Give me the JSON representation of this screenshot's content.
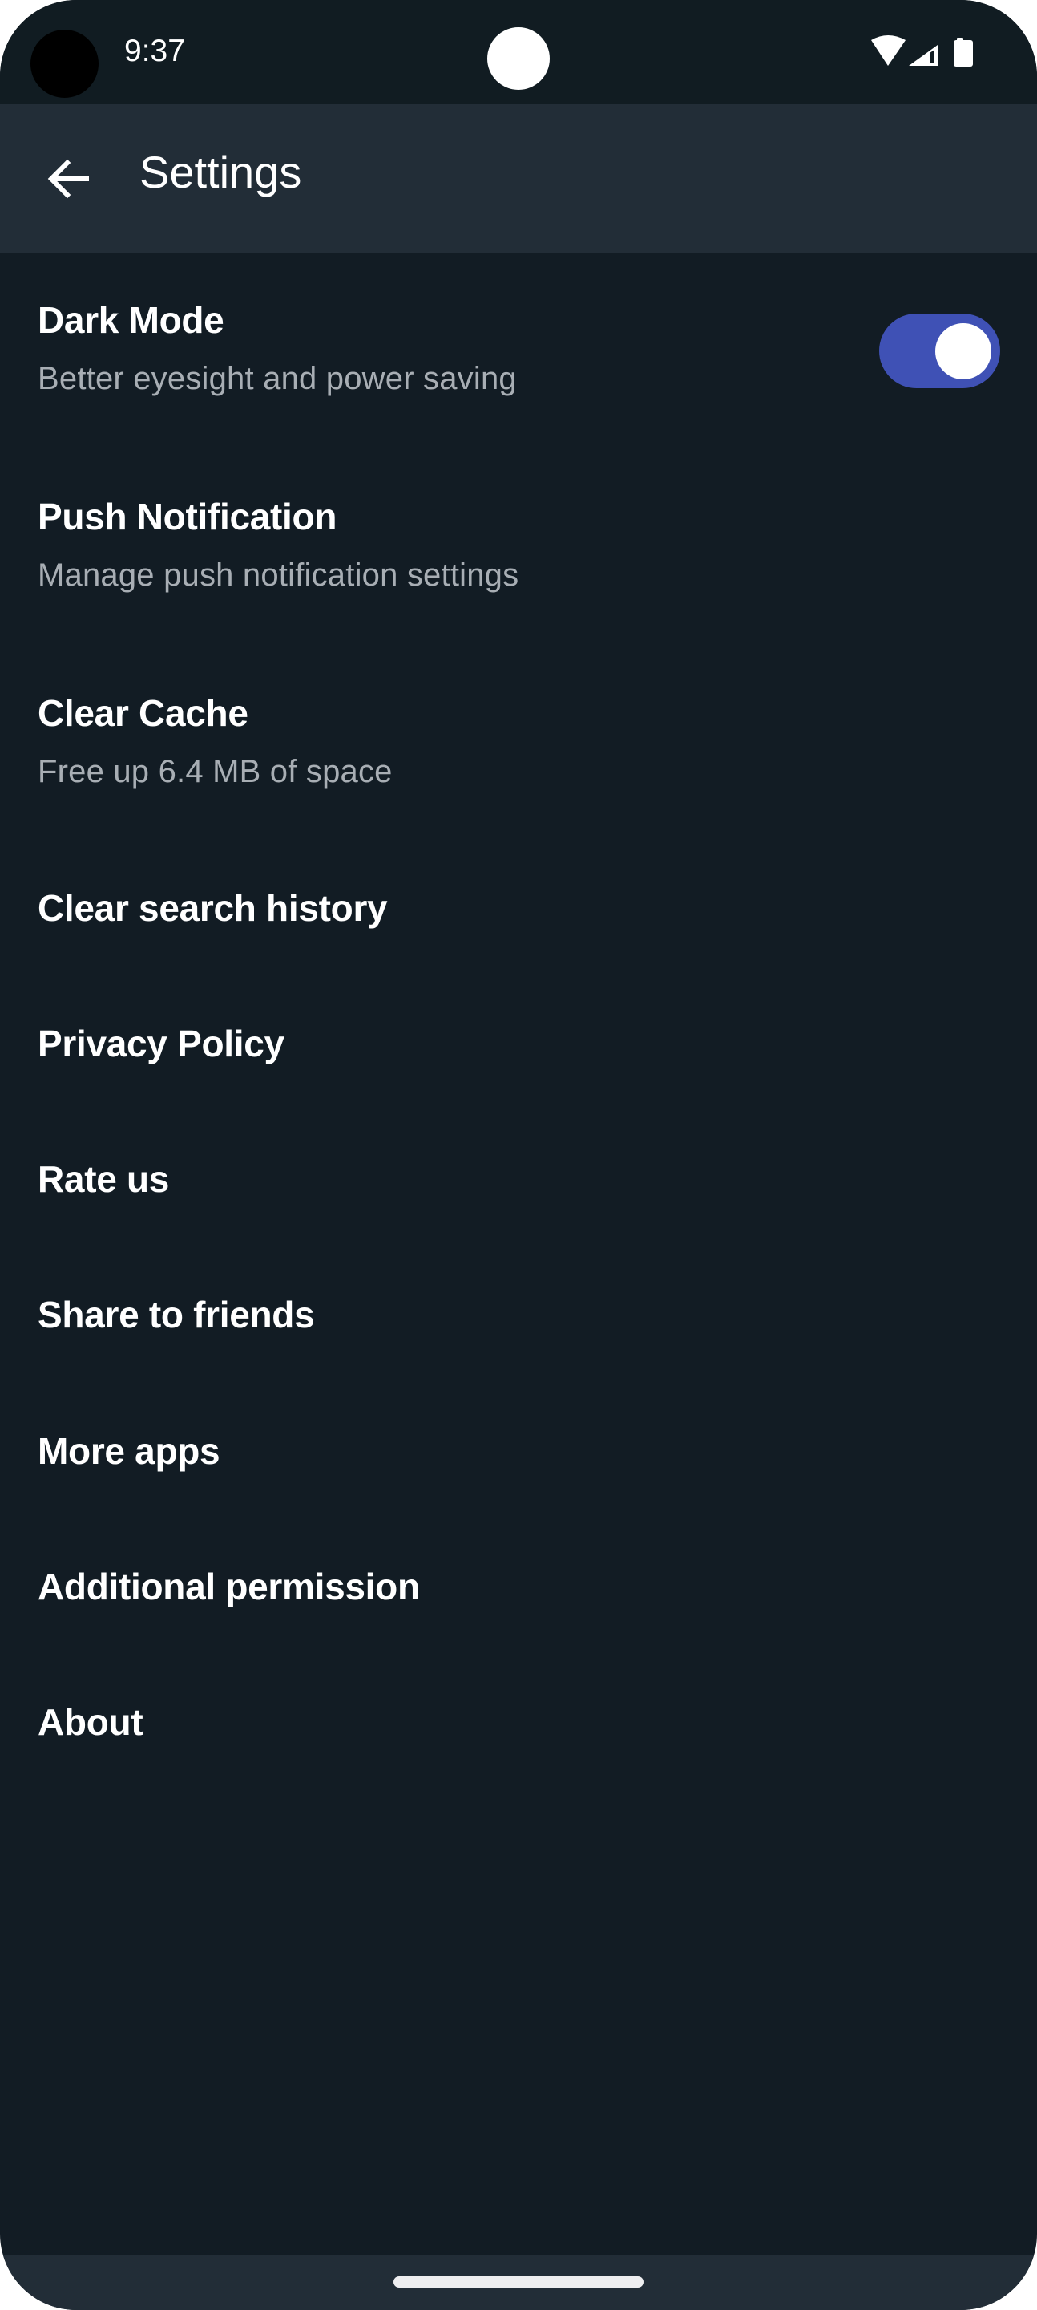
{
  "status_bar": {
    "time": "9:37",
    "icons": [
      "wifi-icon",
      "cellular-signal-icon",
      "battery-icon"
    ]
  },
  "app_bar": {
    "back_icon": "arrow-left-icon",
    "title": "Settings"
  },
  "settings": [
    {
      "title": "Dark Mode",
      "subtitle": "Better eyesight and power saving",
      "toggle": true,
      "toggle_on": true
    },
    {
      "title": "Push Notification",
      "subtitle": "Manage push notification settings"
    },
    {
      "title": "Clear Cache",
      "subtitle": "Free up 6.4 MB of space"
    },
    {
      "title": "Clear search history"
    },
    {
      "title": "Privacy Policy"
    },
    {
      "title": "Rate us"
    },
    {
      "title": "Share to friends"
    },
    {
      "title": "More apps"
    },
    {
      "title": "Additional permission"
    },
    {
      "title": "About"
    }
  ],
  "colors": {
    "background": "#121c24",
    "app_bar": "#222d37",
    "accent": "#3f51b5",
    "subtitle": "#a8aeb4"
  }
}
